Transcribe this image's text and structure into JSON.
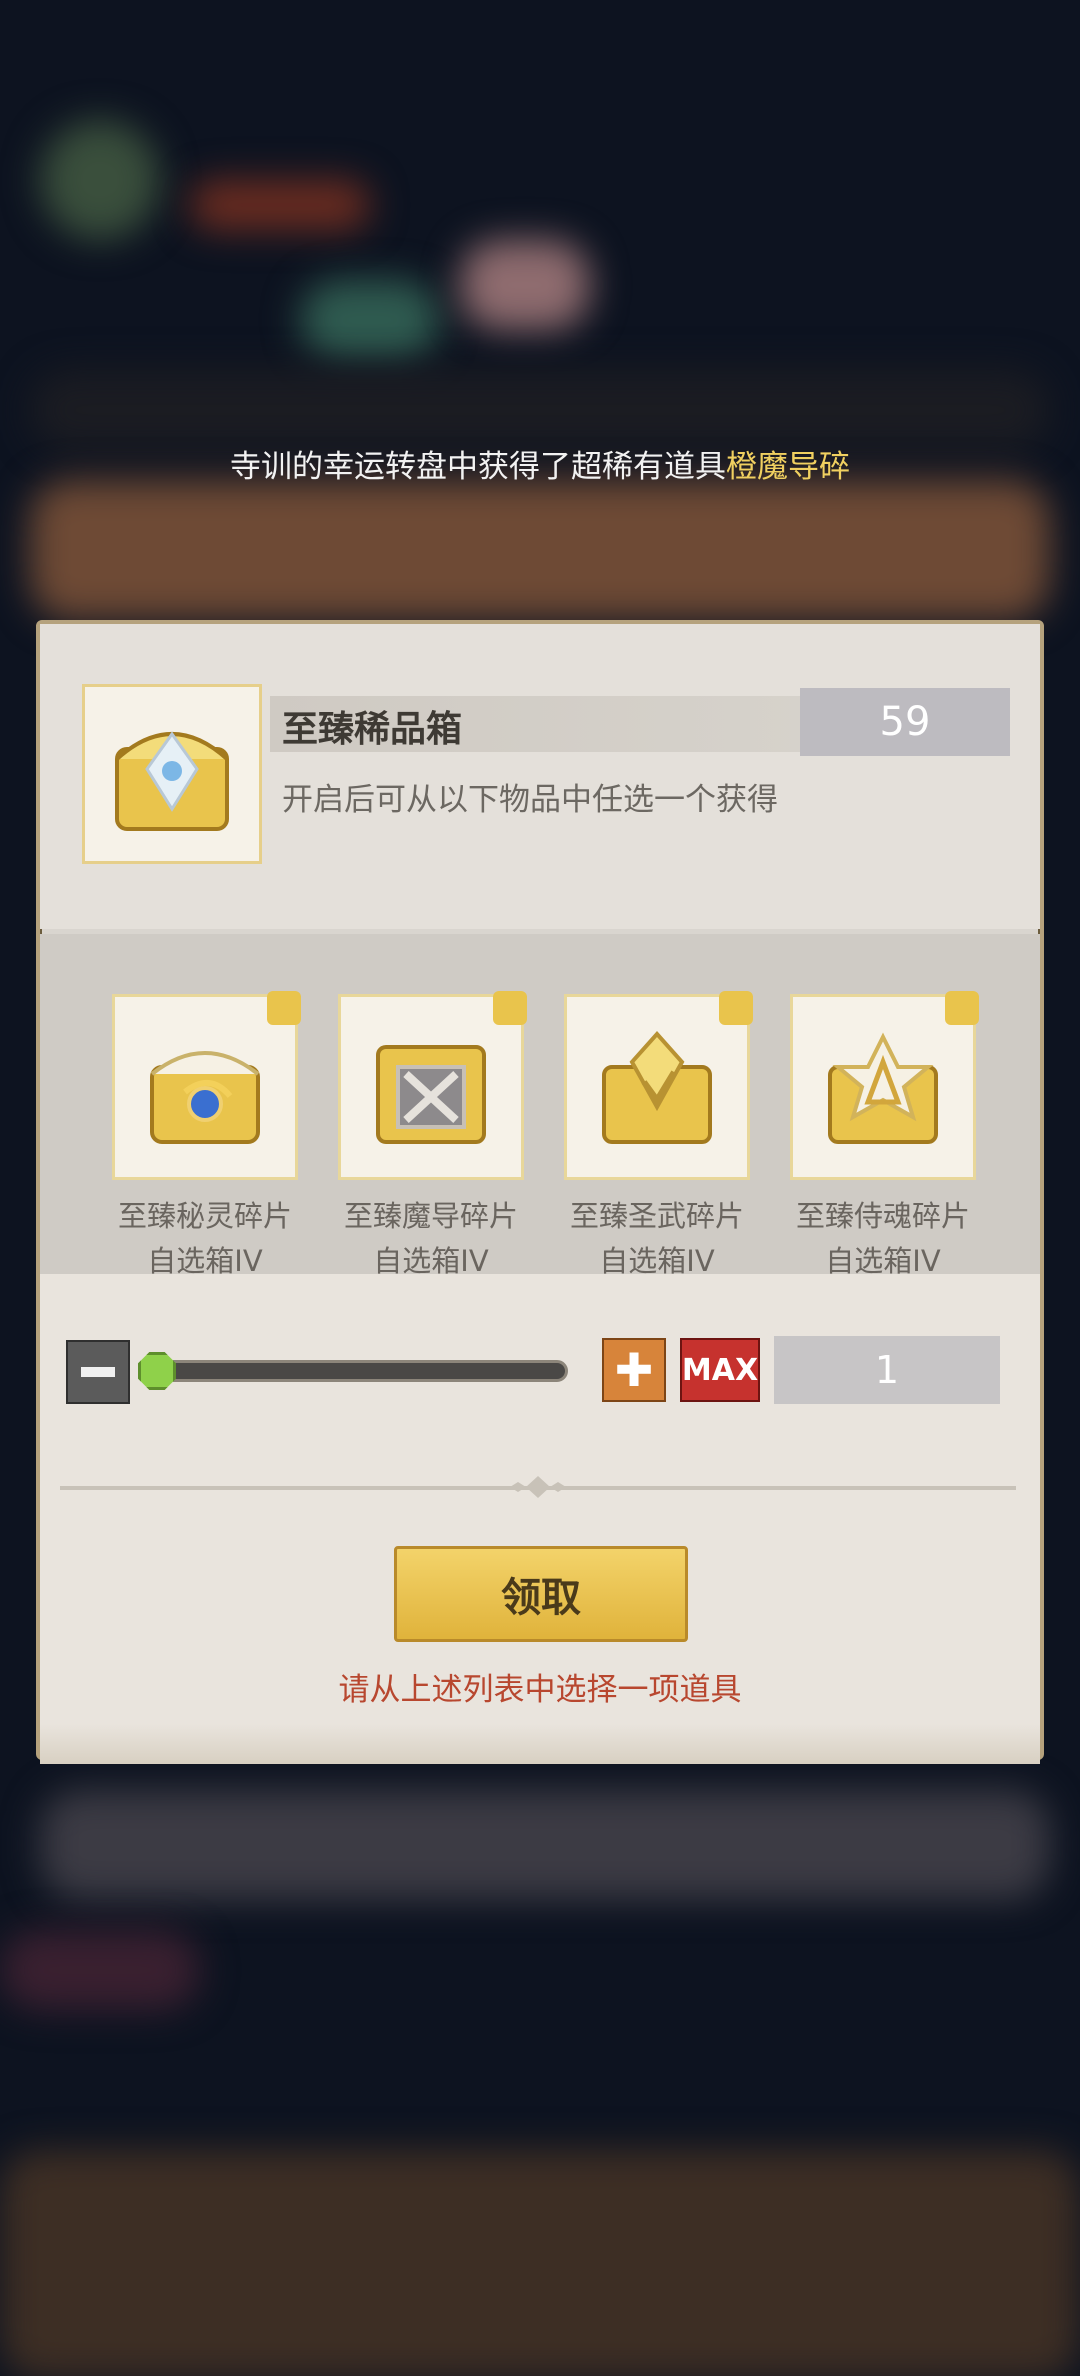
{
  "notice": {
    "text_prefix": "寺训的幸运转盘中获得了超稀有道具",
    "text_highlight": "橙魔导碎"
  },
  "dialog": {
    "title": "至臻稀品箱",
    "owned_count": "59",
    "description": "开启后可从以下物品中任选一个获得",
    "items": [
      {
        "name_line1": "至臻秘灵碎片",
        "name_line2": "自选箱IV",
        "icon": "gold-chest-dragon-icon"
      },
      {
        "name_line1": "至臻魔导碎片",
        "name_line2": "自选箱IV",
        "icon": "gold-chest-cross-icon"
      },
      {
        "name_line1": "至臻圣武碎片",
        "name_line2": "自选箱IV",
        "icon": "gold-chest-sword-icon"
      },
      {
        "name_line1": "至臻侍魂碎片",
        "name_line2": "自选箱IV",
        "icon": "gold-chest-star-icon"
      }
    ],
    "quantity": "1",
    "max_label": "MAX",
    "claim_label": "领取",
    "hint": "请从上述列表中选择一项道具"
  },
  "colors": {
    "highlight": "#f0d060",
    "hint": "#b8472f",
    "claim_button": "#e8c24f"
  }
}
